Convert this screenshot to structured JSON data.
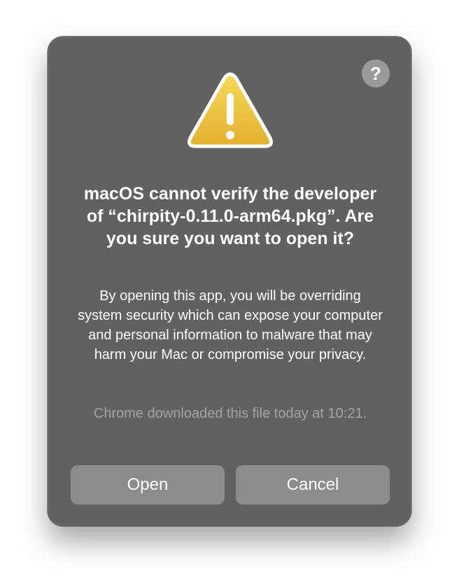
{
  "dialog": {
    "help_label": "?",
    "icon": "warning-triangle-icon",
    "title": "macOS cannot verify the developer of “chirpity-0.11.0-arm64.pkg”. Are you sure you want to open it?",
    "message": "By opening this app, you will be overriding system security which can expose your computer and personal information to malware that may harm your Mac or compromise your privacy.",
    "download_note": "Chrome downloaded this file today at 10:21.",
    "buttons": {
      "open": "Open",
      "cancel": "Cancel"
    }
  },
  "colors": {
    "dialog_background": "#616161",
    "button_background": "#8c8c8c",
    "warning_yellow": "#f0c53d",
    "muted_text": "#a3a3a3"
  }
}
